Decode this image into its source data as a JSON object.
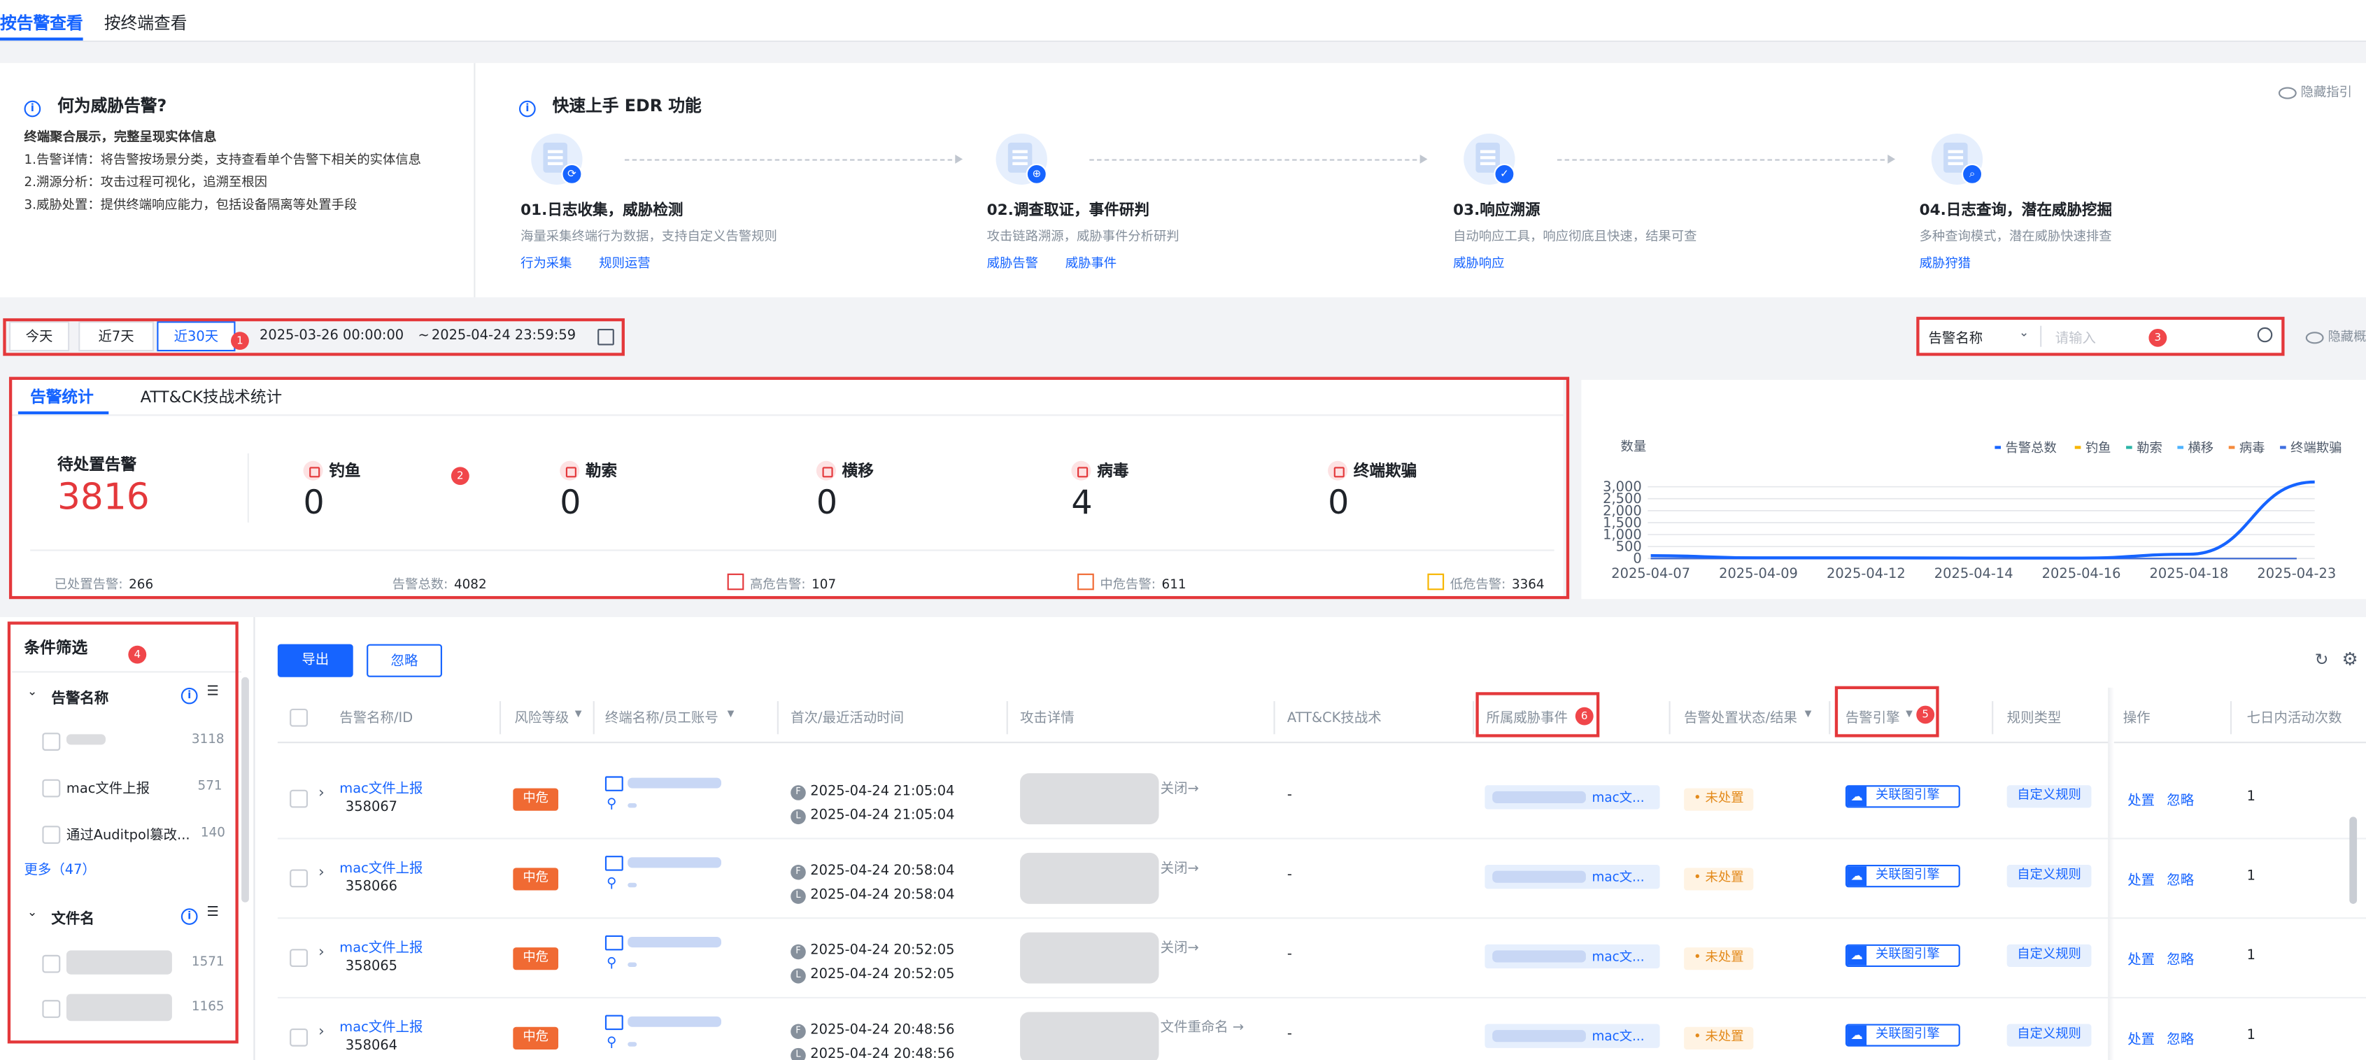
{
  "tabs": {
    "alert_view": "按告警查看",
    "terminal_view": "按终端查看"
  },
  "what_is": {
    "title": "何为威胁告警?",
    "summary": "终端聚合展示，完整呈现实体信息",
    "points": [
      "1.告警详情：将告警按场景分类，支持查看单个告警下相关的实体信息",
      "2.溯源分析：攻击过程可视化，追溯至根因",
      "3.威胁处置：提供终端响应能力，包括设备隔离等处置手段"
    ]
  },
  "quickstart": {
    "title": "快速上手 EDR 功能",
    "hide_label": "隐藏指引",
    "steps": [
      {
        "title": "01.日志收集，威胁检测",
        "desc": "海量采集终端行为数据，支持自定义告警规则",
        "links": [
          "行为采集",
          "规则运营"
        ]
      },
      {
        "title": "02.调查取证，事件研判",
        "desc": "攻击链路溯源，威胁事件分析研判",
        "links": [
          "威胁告警",
          "威胁事件"
        ]
      },
      {
        "title": "03.响应溯源",
        "desc": "自动响应工具，响应彻底且快速，结果可查",
        "links": [
          "威胁响应"
        ]
      },
      {
        "title": "04.日志查询，潜在威胁挖掘",
        "desc": "多种查询模式，潜在威胁快速排查",
        "links": [
          "威胁狩猎"
        ]
      }
    ]
  },
  "time_filter": {
    "today": "今天",
    "week": "近7天",
    "month": "近30天",
    "start": "2025-03-26 00:00:00",
    "sep": "~",
    "end": "2025-04-24 23:59:59"
  },
  "search": {
    "field": "告警名称",
    "placeholder": "请输入",
    "hide_label": "隐藏概"
  },
  "badges": {
    "b1": "1",
    "b2": "2",
    "b3": "3",
    "b4": "4",
    "b5": "5",
    "b6": "6"
  },
  "stats": {
    "tab_alert": "告警统计",
    "tab_attck": "ATT&CK技战术统计",
    "pending_label": "待处置告警",
    "pending_value": "3816",
    "categories": [
      {
        "name": "钓鱼",
        "value": "0"
      },
      {
        "name": "勒索",
        "value": "0"
      },
      {
        "name": "横移",
        "value": "0"
      },
      {
        "name": "病毒",
        "value": "4"
      },
      {
        "name": "终端欺骗",
        "value": "0"
      }
    ],
    "footer": {
      "handled_label": "已处置告警:",
      "handled_value": "266",
      "total_label": "告警总数:",
      "total_value": "4082",
      "high_label": "高危告警:",
      "high_value": "107",
      "mid_label": "中危告警:",
      "mid_value": "611",
      "low_label": "低危告警:",
      "low_value": "3364"
    }
  },
  "chart_data": {
    "type": "line",
    "ylabel": "数量",
    "yticks": [
      "3,000",
      "2,500",
      "2,000",
      "1,500",
      "1,000",
      "500",
      "0"
    ],
    "ylim": [
      0,
      3200
    ],
    "x": [
      "2025-04-07",
      "2025-04-09",
      "2025-04-12",
      "2025-04-14",
      "2025-04-16",
      "2025-04-18",
      "2025-04-23"
    ],
    "legend_position": "top-right",
    "series": [
      {
        "name": "告警总数",
        "color": "#1664ff",
        "values": [
          120,
          30,
          30,
          20,
          20,
          180,
          3200
        ]
      },
      {
        "name": "钓鱼",
        "color": "#f7b500",
        "values": [
          0,
          0,
          0,
          0,
          0,
          0,
          0
        ]
      },
      {
        "name": "勒索",
        "color": "#2bb5a7",
        "values": [
          0,
          0,
          0,
          0,
          0,
          0,
          0
        ]
      },
      {
        "name": "横移",
        "color": "#4cb3ff",
        "values": [
          0,
          0,
          0,
          0,
          0,
          0,
          0
        ]
      },
      {
        "name": "病毒",
        "color": "#f58a3c",
        "values": [
          0,
          0,
          0,
          0,
          0,
          0,
          0
        ]
      },
      {
        "name": "终端欺骗",
        "color": "#3f6fe0",
        "values": [
          0,
          0,
          0,
          0,
          0,
          0,
          0
        ]
      }
    ]
  },
  "filters": {
    "title": "条件筛选",
    "group1": {
      "label": "告警名称",
      "items": [
        {
          "name": "",
          "count": "3118"
        },
        {
          "name": "mac文件上报",
          "count": "571"
        },
        {
          "name": "通过Auditpol篡改...",
          "count": "140"
        }
      ],
      "more": "更多（47）"
    },
    "group2": {
      "label": "文件名",
      "items": [
        {
          "count": "1571"
        },
        {
          "count": "1165"
        }
      ]
    }
  },
  "toolbar": {
    "export": "导出",
    "ignore": "忽略"
  },
  "table": {
    "headers": {
      "name": "告警名称/ID",
      "risk": "风险等级",
      "terminal": "终端名称/员工账号",
      "time": "首次/最近活动时间",
      "attack": "攻击详情",
      "attck": "ATT&CK技战术",
      "event": "所属威胁事件",
      "status": "告警处置状态/结果",
      "engine": "告警引擎",
      "ruletype": "规则类型",
      "ops": "操作",
      "seven": "七日内活动次数"
    },
    "rows": [
      {
        "name": "mac文件上报",
        "id": "358067",
        "risk": "中危",
        "first": "2025-04-24 21:05:04",
        "last": "2025-04-24 21:05:04",
        "attack_tail": "关闭→",
        "attck": "-",
        "event": "mac文...",
        "status": "• 未处置",
        "engine": "关联图引擎",
        "rule": "自定义规则",
        "op1": "处置",
        "op2": "忽略",
        "count": "1"
      },
      {
        "name": "mac文件上报",
        "id": "358066",
        "risk": "中危",
        "first": "2025-04-24 20:58:04",
        "last": "2025-04-24 20:58:04",
        "attack_tail": "关闭→",
        "attck": "-",
        "event": "mac文...",
        "status": "• 未处置",
        "engine": "关联图引擎",
        "rule": "自定义规则",
        "op1": "处置",
        "op2": "忽略",
        "count": "1"
      },
      {
        "name": "mac文件上报",
        "id": "358065",
        "risk": "中危",
        "first": "2025-04-24 20:52:05",
        "last": "2025-04-24 20:52:05",
        "attack_tail": "关闭→",
        "attck": "-",
        "event": "mac文...",
        "status": "• 未处置",
        "engine": "关联图引擎",
        "rule": "自定义规则",
        "op1": "处置",
        "op2": "忽略",
        "count": "1"
      },
      {
        "name": "mac文件上报",
        "id": "358064",
        "risk": "中危",
        "first": "2025-04-24 20:48:56",
        "last": "2025-04-24 20:48:56",
        "attack_tail": "文件重命名 →",
        "attck": "-",
        "event": "mac文...",
        "status": "• 未处置",
        "engine": "关联图引擎",
        "rule": "自定义规则",
        "op1": "处置",
        "op2": "忽略",
        "count": "1"
      }
    ]
  }
}
